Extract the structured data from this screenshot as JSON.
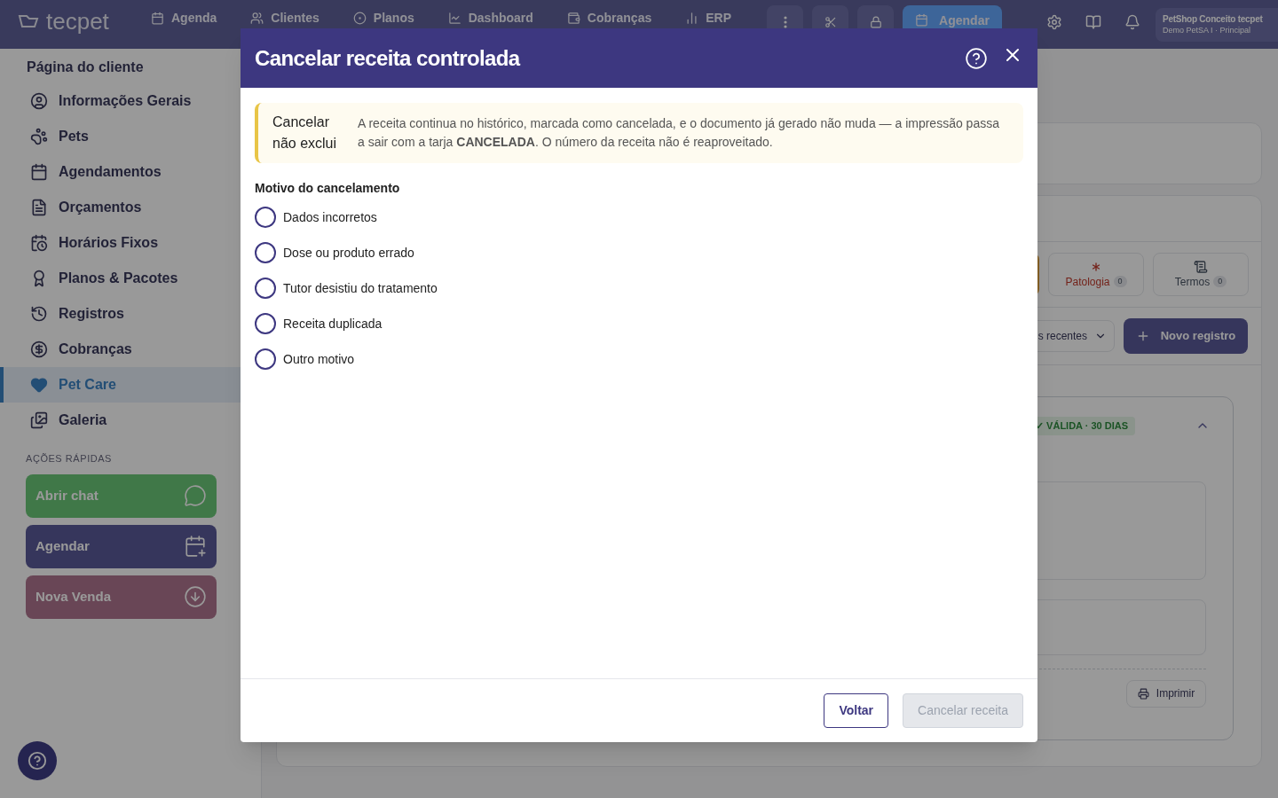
{
  "topbar": {
    "logo": "tecpet",
    "nav": [
      {
        "label": "Agenda"
      },
      {
        "label": "Clientes"
      },
      {
        "label": "Planos"
      },
      {
        "label": "Dashboard"
      },
      {
        "label": "Cobranças"
      },
      {
        "label": "ERP"
      }
    ],
    "action": "Agendar",
    "account": {
      "name": "PetShop Conceito tecpet",
      "unit": "Demo PetSA I · Principal"
    }
  },
  "sidebar": {
    "title": "Página do cliente",
    "items": [
      {
        "label": "Informações Gerais",
        "selected": false
      },
      {
        "label": "Pets",
        "selected": false
      },
      {
        "label": "Agendamentos",
        "selected": false
      },
      {
        "label": "Orçamentos",
        "selected": false
      },
      {
        "label": "Horários Fixos",
        "selected": false
      },
      {
        "label": "Planos & Pacotes",
        "selected": false
      },
      {
        "label": "Registros",
        "selected": false
      },
      {
        "label": "Cobranças",
        "selected": false
      },
      {
        "label": "Pet Care",
        "selected": true
      },
      {
        "label": "Galeria",
        "selected": false
      }
    ],
    "quick_title": "AÇÕES RÁPIDAS",
    "quick_actions": [
      {
        "label": "Abrir chat",
        "kind": "chat"
      },
      {
        "label": "Agendar",
        "kind": "schedule"
      },
      {
        "label": "Nova Venda",
        "kind": "sale"
      }
    ]
  },
  "background": {
    "tabs": [
      {
        "label": "Patologia",
        "count": "0",
        "kind": "pathology"
      },
      {
        "label": "Termos",
        "count": "0",
        "kind": "terms"
      }
    ],
    "sort": "s recentes",
    "new_button": "Novo registro",
    "record": {
      "badge": "✓ VÁLIDA · 30 DIAS",
      "print": "Imprimir"
    }
  },
  "dialog": {
    "title": "Cancelar receita controlada",
    "notice": {
      "title": "Cancelar não exclui",
      "text": "A receita continua no histórico, marcada como cancelada, e o documento já gerado não muda — a impressão passa a sair com a tarja **CANCELADA**. O número da receita não é reaproveitado."
    },
    "reason_label": "Motivo do cancelamento",
    "reasons": [
      {
        "label": "Dados incorretos",
        "selected": false
      },
      {
        "label": "Dose ou produto errado",
        "selected": false
      },
      {
        "label": "Tutor desistiu do tratamento",
        "selected": false
      },
      {
        "label": "Receita duplicada",
        "selected": false
      },
      {
        "label": "Outro motivo",
        "selected": false
      }
    ],
    "buttons": [
      {
        "label": "Voltar",
        "disabled": false,
        "kind": "secondary"
      },
      {
        "label": "Cancelar receita",
        "disabled": true,
        "kind": "primary"
      }
    ]
  }
}
